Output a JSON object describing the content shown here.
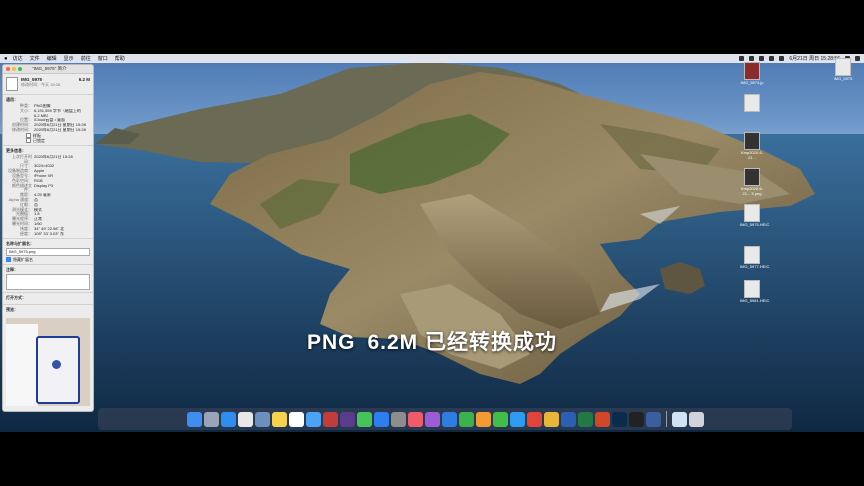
{
  "menubar": {
    "items": [
      "访达",
      "文件",
      "编辑",
      "显示",
      "前往",
      "窗口",
      "帮助"
    ],
    "clock": "6月21日 周日 15:28:56"
  },
  "info_window": {
    "title": "\"IMG_5975\" 简介",
    "file_name": "IMG_5975",
    "file_size": "6.2 M",
    "modified_short": "修改时间：今天 15:28",
    "general_title": "通用：",
    "general": [
      {
        "k": "种类：",
        "v": "PNG图像"
      },
      {
        "k": "大小：",
        "v": "6,191,559 字节（磁盘上的"
      },
      {
        "k": "",
        "v": "6.2 MB）"
      },
      {
        "k": "位置：",
        "v": "iCloud云盘 • 桌面"
      },
      {
        "k": "创建时间：",
        "v": "2020年6月21日 星期日 15:28"
      },
      {
        "k": "修改时间：",
        "v": "2020年6月21日 星期日 15:28"
      }
    ],
    "checkbox_template": "样板",
    "checkbox_locked": "已锁定",
    "more_title": "更多信息：",
    "more": [
      {
        "k": "上次打开时间：",
        "v": "2020年6月21日 15:28"
      },
      {
        "k": "尺寸：",
        "v": "3024×4032"
      },
      {
        "k": "设备制造商：",
        "v": "Apple"
      },
      {
        "k": "设备型号：",
        "v": "iPhone XR"
      },
      {
        "k": "色彩空间：",
        "v": "RGB"
      },
      {
        "k": "颜色描述文件：",
        "v": "Display P3"
      },
      {
        "k": "焦距：",
        "v": "4.25 毫米"
      },
      {
        "k": "Alpha 通道：",
        "v": "否"
      },
      {
        "k": "红眼：",
        "v": "否"
      },
      {
        "k": "测光模式：",
        "v": "模式"
      },
      {
        "k": "光圈值：",
        "v": "1.8"
      },
      {
        "k": "曝光程序：",
        "v": "正常"
      },
      {
        "k": "曝光时间：",
        "v": "1/60"
      },
      {
        "k": "纬度：",
        "v": "34° 49' 22.98\" 北"
      },
      {
        "k": "经度：",
        "v": "108° 33' 3.03\" 东"
      }
    ],
    "name_title": "名称与扩展名：",
    "name_value": "IMG_5975.png",
    "hide_ext": "隐藏扩展名",
    "comments_title": "注释：",
    "open_with_title": "打开方式：",
    "preview_title": "预览："
  },
  "desktop_icons": [
    {
      "label": "IMG_5975"
    },
    {
      "label": "IMG_5974.jp"
    },
    {
      "label": ""
    },
    {
      "label": "Kmp2020-6-21..."
    },
    {
      "label": "Kmp2020-6-21... 5.png"
    },
    {
      "label": "IMG_5975.HEIC"
    },
    {
      "label": "IMG_5977.HEIC"
    },
    {
      "label": "IMG_5981.HEIC"
    }
  ],
  "dock_apps": [
    {
      "name": "finder-app",
      "color": "#3e8ef0"
    },
    {
      "name": "launchpad-app",
      "color": "#9aa4b8"
    },
    {
      "name": "safari-app",
      "color": "#2f8df2"
    },
    {
      "name": "photos-app",
      "color": "#e8e8e8"
    },
    {
      "name": "preview-app",
      "color": "#6b8fbf"
    },
    {
      "name": "notes-app",
      "color": "#f5d34c"
    },
    {
      "name": "calendar-app",
      "color": "#ffffff"
    },
    {
      "name": "mail-app",
      "color": "#4ba3f5"
    },
    {
      "name": "photobooth-app",
      "color": "#c23c3c"
    },
    {
      "name": "imovie-app",
      "color": "#5a3c8c"
    },
    {
      "name": "messages-app",
      "color": "#45c45a"
    },
    {
      "name": "appstore-app",
      "color": "#2d7ff0"
    },
    {
      "name": "settings-app",
      "color": "#8d8d8d"
    },
    {
      "name": "music-app",
      "color": "#f05a6a"
    },
    {
      "name": "podcasts-app",
      "color": "#9b5cd6"
    },
    {
      "name": "keynote-app",
      "color": "#2f7de0"
    },
    {
      "name": "numbers-app",
      "color": "#3bb24b"
    },
    {
      "name": "pages-app",
      "color": "#f29b35"
    },
    {
      "name": "wechat-app",
      "color": "#3fbf4a"
    },
    {
      "name": "qq-app",
      "color": "#2d9cf0"
    },
    {
      "name": "weibo-app",
      "color": "#e2433a"
    },
    {
      "name": "chrome-app",
      "color": "#e8b73a"
    },
    {
      "name": "word-app",
      "color": "#2b5fb4"
    },
    {
      "name": "excel-app",
      "color": "#217a45"
    },
    {
      "name": "powerpoint-app",
      "color": "#d24726"
    },
    {
      "name": "photoshop-app",
      "color": "#0b2b4a"
    },
    {
      "name": "terminal-app",
      "color": "#222222"
    },
    {
      "name": "quicktime-app",
      "color": "#3a5f9c"
    },
    {
      "name": "downloads-stack",
      "color": "#cfe3f5"
    },
    {
      "name": "trash-app",
      "color": "#d0d4da"
    }
  ],
  "caption": {
    "format": "PNG",
    "size": "6.2M",
    "message": "已经转换成功"
  }
}
